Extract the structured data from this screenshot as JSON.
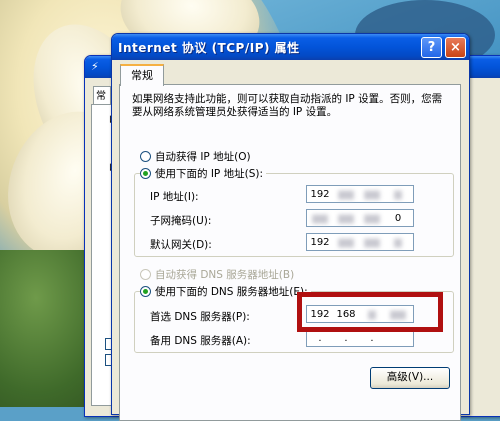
{
  "dialog": {
    "title": "Internet 协议 (TCP/IP) 属性",
    "help_btn": "?",
    "close_btn": "×",
    "tab_general": "常规",
    "intro": "如果网络支持此功能，则可以获取自动指派的 IP 设置。否则，您需要从网络系统管理员处获得适当的 IP 设置。",
    "auto_ip_label": "自动获得 IP 地址(O)",
    "manual_ip_label": "使用下面的 IP 地址(S):",
    "ip_address_label": "IP 地址(I):",
    "ip_address_value": [
      "192",
      "",
      "",
      ""
    ],
    "subnet_label": "子网掩码(U):",
    "subnet_value": [
      "",
      "",
      "",
      "0"
    ],
    "gateway_label": "默认网关(D):",
    "gateway_value": [
      "192",
      "",
      "",
      ""
    ],
    "auto_dns_label": "自动获得 DNS 服务器地址(B)",
    "manual_dns_label": "使用下面的 DNS 服务器地址(E):",
    "primary_dns_label": "首选 DNS 服务器(P):",
    "primary_dns_value": [
      "192",
      "168",
      "",
      ""
    ],
    "alt_dns_label": "备用 DNS 服务器(A):",
    "alt_dns_value": [
      "",
      "",
      "",
      ""
    ],
    "advanced_button": "高级(V)..."
  },
  "background_window": {
    "tab_fragment": "常"
  },
  "colors": {
    "title_blue": "#0354d9",
    "highlight_red": "#b01010",
    "radio_selected": "#21a121",
    "dialog_face": "#ece9d8"
  },
  "selection": {
    "ip_mode": "manual",
    "dns_mode": "manual"
  }
}
